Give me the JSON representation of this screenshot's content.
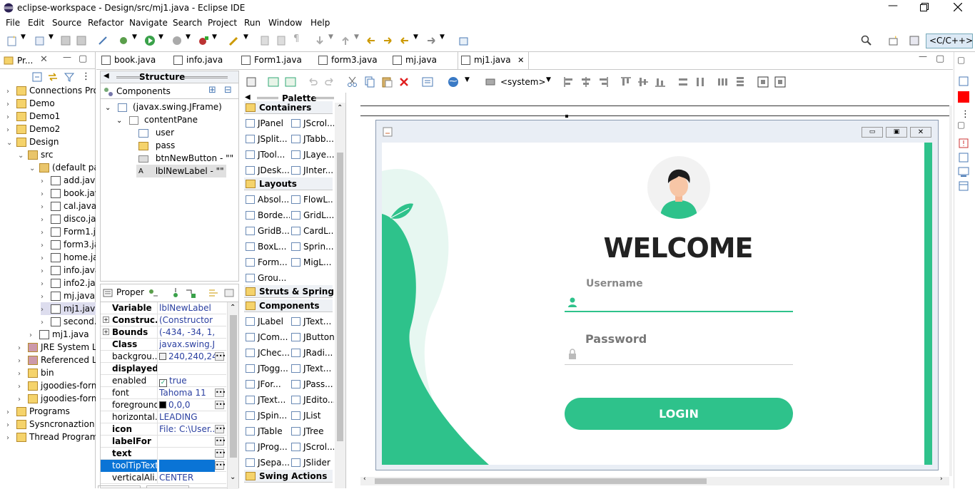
{
  "window": {
    "title": "eclipse-workspace - Design/src/mj1.java - Eclipse IDE"
  },
  "menu": [
    "File",
    "Edit",
    "Source",
    "Refactor",
    "Navigate",
    "Search",
    "Project",
    "Run",
    "Window",
    "Help"
  ],
  "perspective": "<C/C++>",
  "package_explorer": {
    "title": "Pr...",
    "items": [
      {
        "label": "Connections Proj",
        "indent": 0
      },
      {
        "label": "Demo",
        "indent": 0
      },
      {
        "label": "Demo1",
        "indent": 0
      },
      {
        "label": "Demo2",
        "indent": 0
      },
      {
        "label": "Design",
        "indent": 0
      },
      {
        "label": "src",
        "indent": 1
      },
      {
        "label": "(default pac",
        "indent": 2
      },
      {
        "label": "add.java",
        "indent": 3
      },
      {
        "label": "book.jav",
        "indent": 3
      },
      {
        "label": "cal.java",
        "indent": 3
      },
      {
        "label": "disco.jav",
        "indent": 3
      },
      {
        "label": "Form1.ja",
        "indent": 3
      },
      {
        "label": "form3.ja",
        "indent": 3
      },
      {
        "label": "home.ja",
        "indent": 3
      },
      {
        "label": "info.java",
        "indent": 3
      },
      {
        "label": "info2.jav",
        "indent": 3
      },
      {
        "label": "mj.java",
        "indent": 3
      },
      {
        "label": "mj1.java",
        "indent": 3
      },
      {
        "label": "second.j",
        "indent": 3
      },
      {
        "label": "mj1.java",
        "indent": 2
      },
      {
        "label": "JRE System Lib",
        "indent": 1
      },
      {
        "label": "Referenced Lib",
        "indent": 1
      },
      {
        "label": "bin",
        "indent": 1
      },
      {
        "label": "jgoodies-form",
        "indent": 1
      },
      {
        "label": "jgoodies-form",
        "indent": 1
      },
      {
        "label": "Programs",
        "indent": 0
      },
      {
        "label": "Sysncronaztion",
        "indent": 0
      },
      {
        "label": "Thread Programn",
        "indent": 0
      }
    ]
  },
  "editor_tabs": [
    "book.java",
    "info.java",
    "Form1.java",
    "form3.java",
    "mj.java",
    "mj1.java"
  ],
  "structure": {
    "title": "Structure",
    "components_title": "Components",
    "tree": [
      "(javax.swing.JFrame)",
      "contentPane",
      "user",
      "pass",
      "btnNewButton - \"\"",
      "lblNewLabel - \"\""
    ]
  },
  "properties": {
    "title": "Proper",
    "rows": [
      {
        "name": "Variable",
        "value": "lblNewLabel",
        "bold": true
      },
      {
        "name": "Construc...",
        "value": "(Constructor pr...",
        "bold": true
      },
      {
        "name": "Bounds",
        "value": "(-434, -34, 1,39...",
        "bold": true
      },
      {
        "name": "Class",
        "value": "javax.swing.JLa...",
        "bold": true
      },
      {
        "name": "backgrou...",
        "value": "240,240,240",
        "bold": false
      },
      {
        "name": "displayed...",
        "value": "",
        "bold": true
      },
      {
        "name": "enabled",
        "value": "true",
        "bold": false
      },
      {
        "name": "font",
        "value": "Tahoma 11",
        "bold": false
      },
      {
        "name": "foreground",
        "value": "0,0,0",
        "bold": false
      },
      {
        "name": "horizontal...",
        "value": "LEADING",
        "bold": false
      },
      {
        "name": "icon",
        "value": "File: C:\\User...",
        "bold": true
      },
      {
        "name": "labelFor",
        "value": "",
        "bold": true
      },
      {
        "name": "text",
        "value": "",
        "bold": true
      },
      {
        "name": "toolTipText",
        "value": "",
        "bold": false
      },
      {
        "name": "verticalAli...",
        "value": "CENTER",
        "bold": false
      }
    ]
  },
  "palette": {
    "title": "Palette",
    "sections": [
      {
        "header": "Containers",
        "items": [
          "JPanel",
          "JScrol...",
          "JSplit...",
          "JTabb...",
          "JTool...",
          "JLaye...",
          "JDesk...",
          "JInter..."
        ]
      },
      {
        "header": "Layouts",
        "items": [
          "Absol...",
          "FlowL...",
          "Borde...",
          "GridL...",
          "GridB...",
          "CardL...",
          "BoxL...",
          "Sprin...",
          "Form...",
          "MigL...",
          "Grou..."
        ]
      },
      {
        "header": "Struts & Springs",
        "items": []
      },
      {
        "header": "Components",
        "items": [
          "JLabel",
          "JText...",
          "JCom...",
          "JButton",
          "JChec...",
          "JRadi...",
          "JTogg...",
          "JText...",
          "JFor...",
          "JPass...",
          "JText...",
          "JEdito...",
          "JSpin...",
          "JList",
          "JTable",
          "JTree",
          "JProg...",
          "JScrol...",
          "JSepa...",
          "JSlider"
        ]
      },
      {
        "header": "Swing Actions",
        "items": []
      }
    ]
  },
  "design_toolbar": {
    "system_combo": "<system>"
  },
  "login_form": {
    "welcome": "WELCOME",
    "username_label": "Username",
    "password_label": "Password",
    "login_button": "LOGIN",
    "accent_color": "#2ec28b"
  }
}
